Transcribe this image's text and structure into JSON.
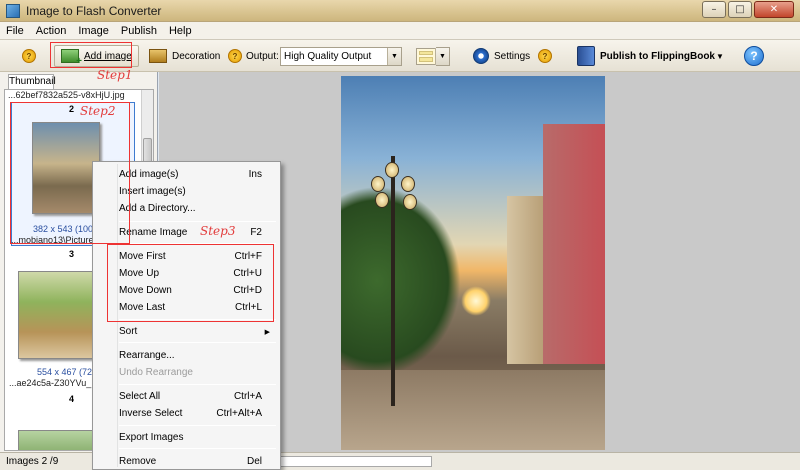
{
  "window": {
    "title": "Image to Flash Converter"
  },
  "menubar": {
    "items": [
      "File",
      "Action",
      "Image",
      "Publish",
      "Help"
    ]
  },
  "toolbar": {
    "help_badge": "?",
    "add_image_label": "Add image",
    "decoration_label": "Decoration",
    "output_label": "Output:",
    "output_value": "High Quality Output",
    "settings_label": "Settings",
    "publish_label": "Publish to FlippingBook",
    "help_label": "?"
  },
  "left_panel": {
    "tab_label": "Thumbnail",
    "thumbs": [
      {
        "top_caption": "...62bef7832a525-v8xHjU.jpg",
        "number": "2",
        "dims": "382 x 543 (100",
        "filename": "...mobiano13\\Picture",
        "next_number": "3"
      },
      {
        "dims": "554 x 467 (72",
        "filename": "...ae24c5a-Z30YVu_",
        "next_number": "4"
      }
    ]
  },
  "context_menu": {
    "items": [
      {
        "label": "Add image(s)",
        "shortcut": "Ins"
      },
      {
        "label": "Insert image(s)",
        "shortcut": ""
      },
      {
        "label": "Add a Directory...",
        "shortcut": ""
      },
      {
        "label": "Rename Image",
        "shortcut": "F2"
      },
      {
        "label": "Move First",
        "shortcut": "Ctrl+F"
      },
      {
        "label": "Move Up",
        "shortcut": "Ctrl+U"
      },
      {
        "label": "Move Down",
        "shortcut": "Ctrl+D"
      },
      {
        "label": "Move Last",
        "shortcut": "Ctrl+L"
      },
      {
        "label": "Sort",
        "shortcut": ""
      },
      {
        "label": "Rearrange...",
        "shortcut": ""
      },
      {
        "label": "Undo Rearrange",
        "shortcut": ""
      },
      {
        "label": "Select All",
        "shortcut": "Ctrl+A"
      },
      {
        "label": "Inverse Select",
        "shortcut": "Ctrl+Alt+A"
      },
      {
        "label": "Export Images",
        "shortcut": ""
      },
      {
        "label": "Remove",
        "shortcut": "Del"
      }
    ]
  },
  "annotations": {
    "step1": "Step1",
    "step2": "Step2",
    "step3": "Step3"
  },
  "statusbar": {
    "text": "Images 2 /9"
  },
  "colors": {
    "annotation_red": "#e33333",
    "selection_blue": "#3e7bd0"
  }
}
